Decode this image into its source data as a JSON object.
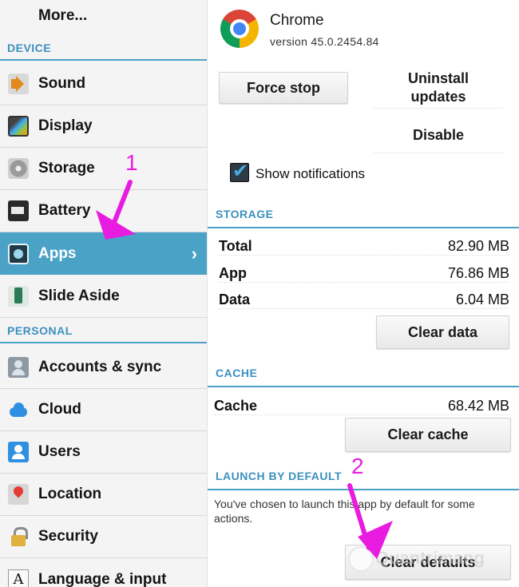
{
  "sidebar": {
    "more": "More...",
    "device_header": "DEVICE",
    "personal_header": "PERSONAL",
    "items": [
      {
        "label": "Sound",
        "icon": "speaker-icon"
      },
      {
        "label": "Display",
        "icon": "display-icon"
      },
      {
        "label": "Storage",
        "icon": "storage-icon"
      },
      {
        "label": "Battery",
        "icon": "battery-icon"
      },
      {
        "label": "Apps",
        "icon": "apps-icon",
        "selected": true
      },
      {
        "label": "Slide Aside",
        "icon": "slide-aside-icon"
      },
      {
        "label": "Accounts & sync",
        "icon": "accounts-icon"
      },
      {
        "label": "Cloud",
        "icon": "cloud-icon"
      },
      {
        "label": "Users",
        "icon": "users-icon"
      },
      {
        "label": "Location",
        "icon": "location-icon"
      },
      {
        "label": "Security",
        "icon": "lock-icon"
      },
      {
        "label": "Language & input",
        "icon": "language-icon"
      }
    ]
  },
  "app_info": {
    "name": "Chrome",
    "version": "version 45.0.2454.84",
    "force_stop": "Force stop",
    "uninstall_updates": "Uninstall updates",
    "disable": "Disable",
    "show_notifications": "Show notifications",
    "show_notifications_checked": true
  },
  "storage": {
    "header": "STORAGE",
    "rows": [
      {
        "label": "Total",
        "value": "82.90 MB"
      },
      {
        "label": "App",
        "value": "76.86 MB"
      },
      {
        "label": "Data",
        "value": "6.04 MB"
      }
    ],
    "clear_data": "Clear data"
  },
  "cache": {
    "header": "CACHE",
    "label": "Cache",
    "value": "68.42 MB",
    "clear_cache": "Clear cache"
  },
  "launch": {
    "header": "LAUNCH BY DEFAULT",
    "text": "You've chosen to launch this app by default for some actions.",
    "clear_defaults": "Clear defaults"
  },
  "annotations": {
    "step1": "1",
    "step2": "2",
    "color": "#e81ce0",
    "watermark": "Quantrimang"
  },
  "colors": {
    "accent": "#4aa2c6",
    "section_text": "#3b8fbf"
  }
}
